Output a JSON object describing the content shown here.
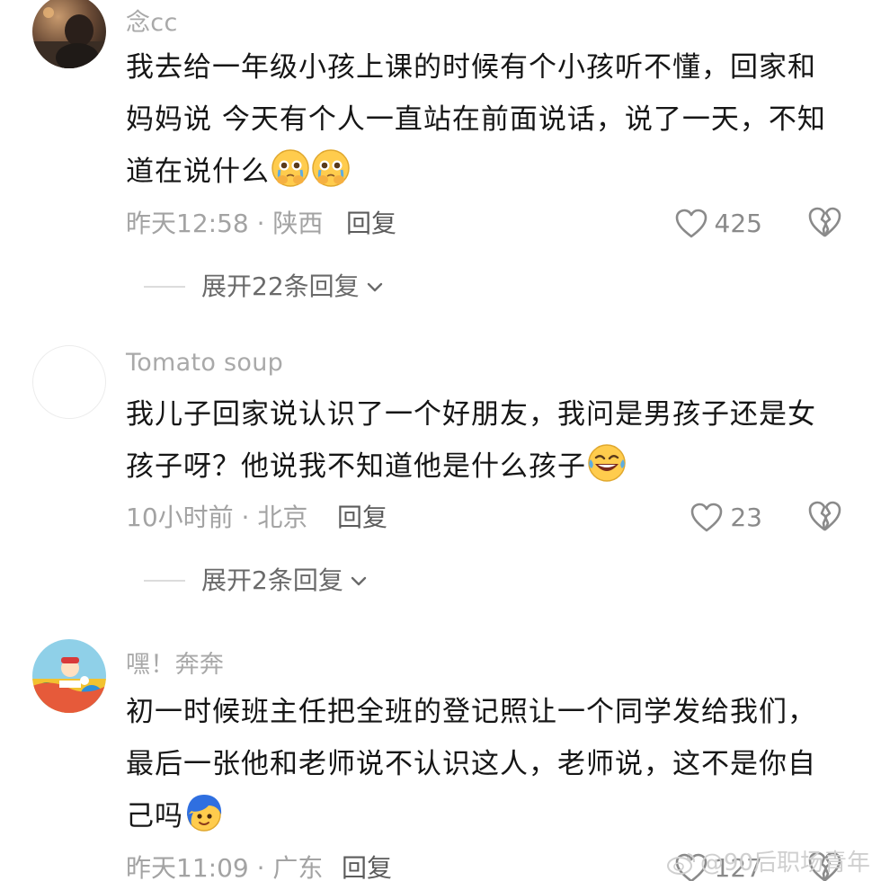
{
  "comments": [
    {
      "username": "念cc",
      "text": "我去给一年级小孩上课的时候有个小孩听不懂，回家和妈妈说 今天有个人一直站在前面说话，说了一天，不知道在说什么",
      "emojis": [
        "pleading-cry-emoji",
        "pleading-cry-emoji"
      ],
      "meta": "昨天12:58 · 陕西",
      "reply_label": "回复",
      "likes": "425",
      "expand_label": "展开22条回复"
    },
    {
      "username": "Tomato soup",
      "text": "我儿子回家说认识了一个好朋友，我问是男孩子还是女孩子呀？他说我不知道他是什么孩子",
      "emojis": [
        "laughing-tears-emoji"
      ],
      "meta": "10小时前 · 北京",
      "reply_label": "回复",
      "likes": "23",
      "expand_label": "展开2条回复"
    },
    {
      "username": "嘿！奔奔",
      "text": "初一时候班主任把全班的登记照让一个同学发给我们，最后一张他和老师说不认识这人，老师说，这不是你自己吗",
      "emojis": [
        "blue-hair-face-emoji"
      ],
      "meta": "昨天11:09 · 广东",
      "reply_label": "回复",
      "likes": "127"
    }
  ],
  "watermark": "@90后职场青年",
  "colors": {
    "text": "#161616",
    "meta": "#a3a3a3",
    "reply": "#5c5c5c",
    "icon": "#8a8a8a"
  }
}
